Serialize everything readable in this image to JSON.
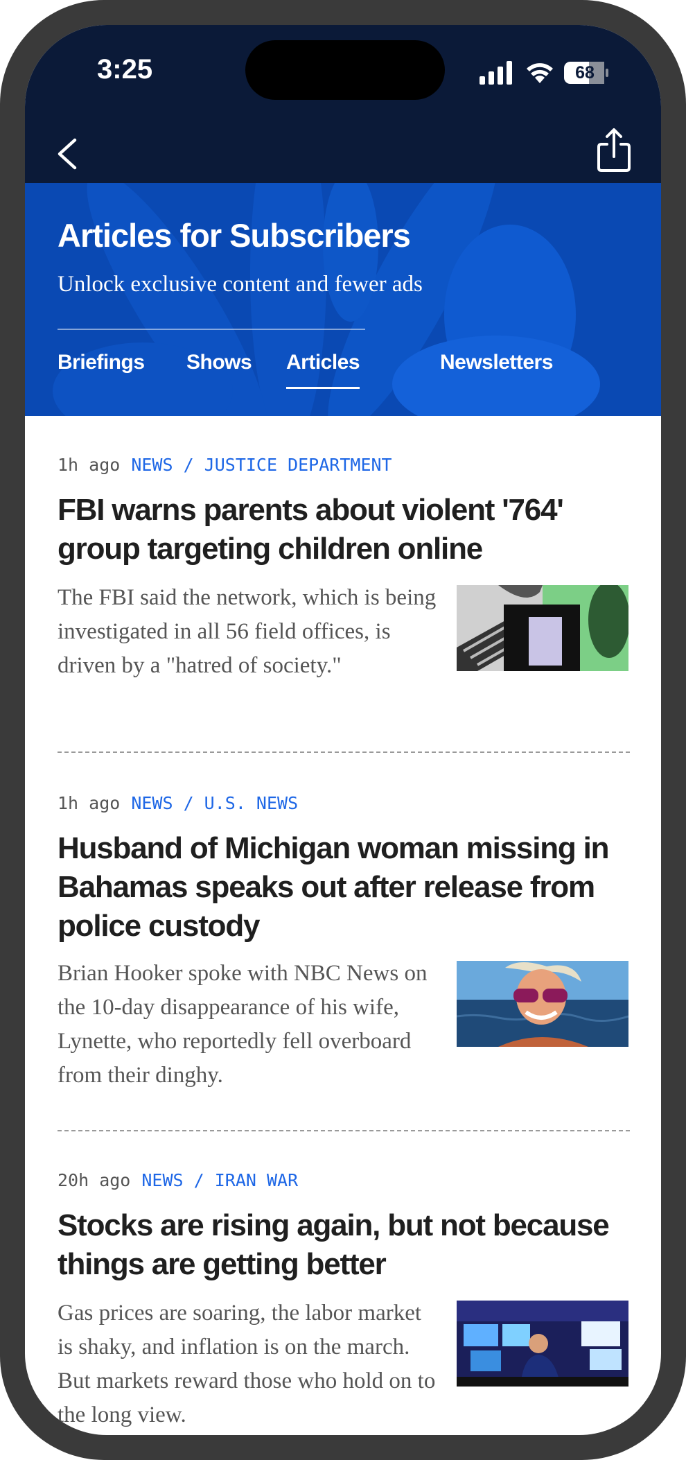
{
  "status_bar": {
    "time": "3:25",
    "battery": "68"
  },
  "hero": {
    "title": "Articles for Subscribers",
    "subtitle": "Unlock exclusive content and fewer ads",
    "tabs": [
      {
        "label": "Briefings",
        "active": false
      },
      {
        "label": "Shows",
        "active": false
      },
      {
        "label": "Articles",
        "active": true
      },
      {
        "label": "Newsletters",
        "active": false
      }
    ]
  },
  "articles": [
    {
      "time_ago": "1h ago",
      "category": "NEWS / JUSTICE DEPARTMENT",
      "headline": "FBI warns parents about violent '764' group targeting children online",
      "summary": "The FBI said the network, which is being investigated in all 56 field offices, is driven by a \"hatred of society.\""
    },
    {
      "time_ago": "1h ago",
      "category": "NEWS / U.S. NEWS",
      "headline": "Husband of Michigan woman missing in Bahamas speaks out after release from police custody",
      "summary": "Brian Hooker spoke with NBC News on the 10-day disappearance of his wife, Lynette, who reportedly fell overboard from their dinghy."
    },
    {
      "time_ago": "20h ago",
      "category": "NEWS / IRAN WAR",
      "headline": "Stocks are rising again, but not because things are getting better",
      "summary": "Gas prices are soaring, the labor market is shaky, and inflation is on the march. But markets reward those who hold on to the long view."
    }
  ],
  "colors": {
    "navy": "#0b1a38",
    "hero_blue": "#0a49b3",
    "link_blue": "#1e67e6"
  }
}
